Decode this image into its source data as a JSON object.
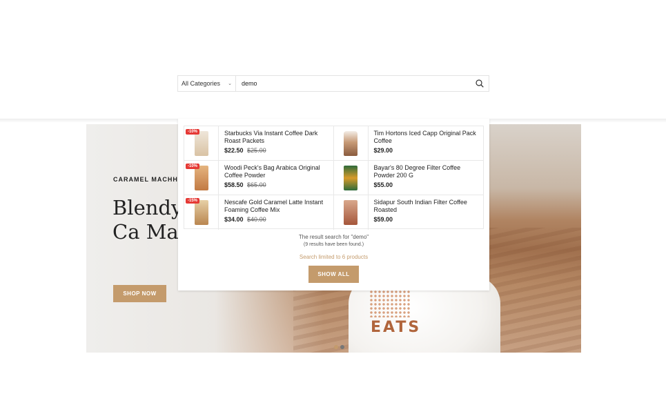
{
  "search": {
    "category": "All Categories",
    "query": "demo"
  },
  "hero": {
    "subtitle": "CARAMEL MACHHIAT",
    "title": "Blendy Stick Ca Macchi",
    "button": "SHOP NOW",
    "cup_text": "EATS",
    "slides": 2,
    "active_slide": 1
  },
  "results": {
    "products": [
      {
        "name": "Starbucks Via Instant Coffee Dark Roast Packets",
        "price": "$22.50",
        "old_price": "$25.00",
        "badge": "-10%"
      },
      {
        "name": "Tim Hortons Iced Capp Original Pack Coffee",
        "price": "$29.00",
        "old_price": "",
        "badge": ""
      },
      {
        "name": "Woodi Peck's Bag Arabica Original Coffee Powder",
        "price": "$58.50",
        "old_price": "$65.00",
        "badge": "-10%"
      },
      {
        "name": "Bayar's 80 Degree Filter Coffee Powder 200 G",
        "price": "$55.00",
        "old_price": "",
        "badge": ""
      },
      {
        "name": "Nescafe Gold Caramel Latte Instant Foaming Coffee Mix",
        "price": "$34.00",
        "old_price": "$40.00",
        "badge": "-15%"
      },
      {
        "name": "Sidapur South Indian Filter Coffee Roasted",
        "price": "$59.00",
        "old_price": "",
        "badge": ""
      }
    ],
    "summary": "The result search for \"demo\"",
    "count": "(9 results have been found.)",
    "limit": "Search limited to 6 products",
    "show_all": "SHOW ALL"
  },
  "colors": {
    "accent": "#c49b6c",
    "badge": "#e53935"
  }
}
